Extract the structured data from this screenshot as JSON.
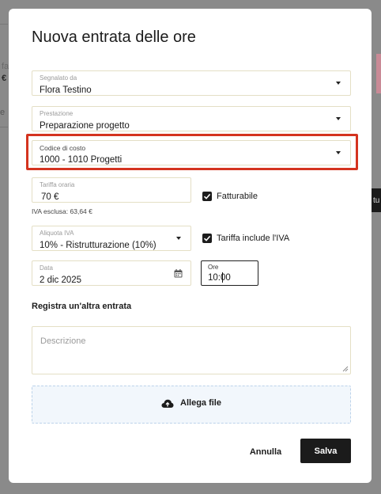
{
  "background": {
    "fragments": [
      "fat",
      "€",
      "e",
      "tu"
    ]
  },
  "modal": {
    "title": "Nuova entrata delle ore",
    "reported_by": {
      "label": "Segnalato da",
      "value": "Flora Testino"
    },
    "service": {
      "label": "Prestazione",
      "value": "Preparazione progetto"
    },
    "cost_code": {
      "label": "Codice di costo",
      "value": "1000 - 1010 Progetti"
    },
    "hourly_rate": {
      "label": "Tariffa oraria",
      "value": "70 €",
      "note": "IVA esclusa: 63,64 €"
    },
    "billable": {
      "label": "Fatturabile",
      "checked": true
    },
    "vat_rate": {
      "label": "Aliquota IVA",
      "value": "10% - Ristrutturazione (10%)"
    },
    "rate_includes_vat": {
      "label": "Tariffa include l'IVA",
      "checked": true
    },
    "date": {
      "label": "Data",
      "value": "2 dic 2025"
    },
    "hours": {
      "label": "Ore",
      "value": "10:00"
    },
    "register_another": "Registra un'altra entrata",
    "description": {
      "placeholder": "Descrizione"
    },
    "attach": {
      "label": "Allega file",
      "icon": "cloud-upload-icon"
    },
    "buttons": {
      "cancel": "Annulla",
      "save": "Salva"
    },
    "colors": {
      "highlight": "#d4331f",
      "field_border": "#e4dfc5",
      "primary_button": "#1b1b1b",
      "dropzone_bg": "#f2f7fc"
    }
  }
}
